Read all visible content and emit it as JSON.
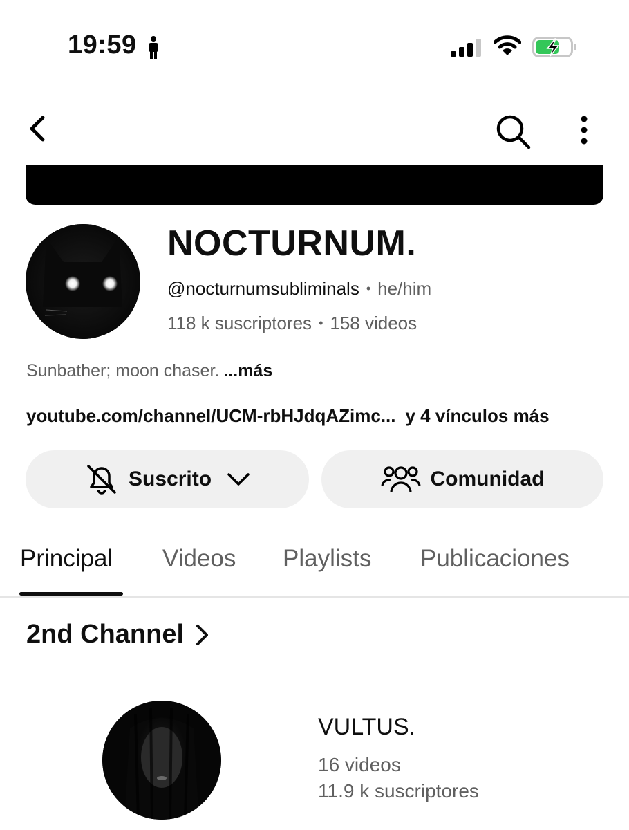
{
  "status_bar": {
    "time": "19:59"
  },
  "channel": {
    "name": "NOCTURNUM.",
    "handle": "@nocturnumsubliminals",
    "pronouns": "he/him",
    "subscribers": "118 k suscriptores",
    "videos": "158 videos",
    "description": "Sunbather; moon chaser.",
    "more_label": "...más",
    "link": "youtube.com/channel/UCM-rbHJdqAZimc...",
    "more_links": "y 4 vínculos más"
  },
  "actions": {
    "subscribed_label": "Suscrito",
    "community_label": "Comunidad"
  },
  "tabs": [
    {
      "label": "Principal",
      "active": true
    },
    {
      "label": "Videos",
      "active": false
    },
    {
      "label": "Playlists",
      "active": false
    },
    {
      "label": "Publicaciones",
      "active": false
    }
  ],
  "section": {
    "title": "2nd Channel",
    "item": {
      "name": "VULTUS.",
      "videos": "16 videos",
      "subscribers": "11.9 k suscriptores"
    }
  },
  "icons": [
    "person-icon",
    "signal-icon",
    "wifi-icon",
    "battery-icon",
    "back-icon",
    "search-icon",
    "more-icon",
    "bell-off-icon",
    "chevron-down-icon",
    "community-icon",
    "chevron-right-icon"
  ]
}
